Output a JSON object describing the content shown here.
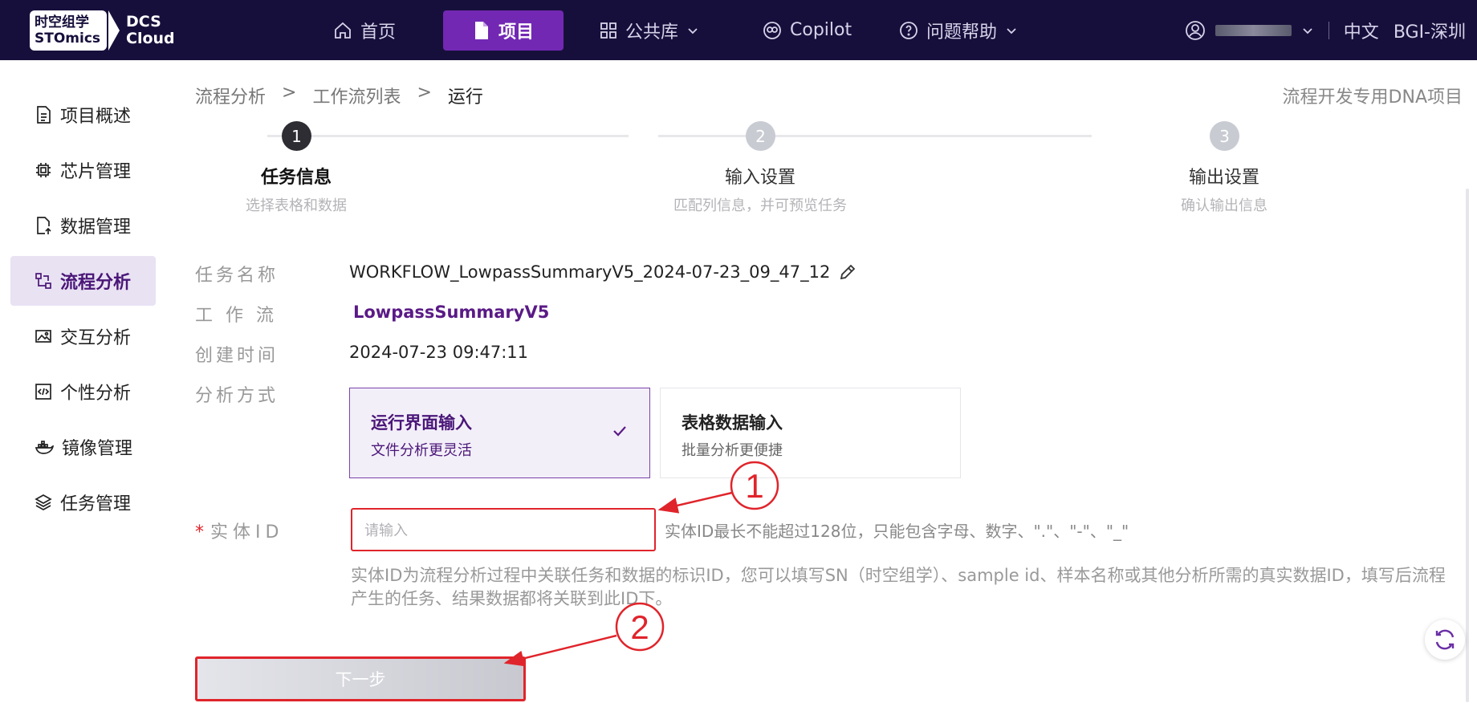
{
  "brand": {
    "logo_line1": "时空组学",
    "logo_line2": "STOmics",
    "product_line1": "DCS",
    "product_line2": "Cloud"
  },
  "nav": [
    {
      "label": "首页",
      "icon": "home-icon",
      "active": false
    },
    {
      "label": "项目",
      "icon": "document-icon",
      "active": true
    },
    {
      "label": "公共库",
      "icon": "grid-icon",
      "active": false,
      "dropdown": true
    },
    {
      "label": "Copilot",
      "icon": "copilot-icon",
      "active": false
    },
    {
      "label": "问题帮助",
      "icon": "help-icon",
      "active": false,
      "dropdown": true
    }
  ],
  "topright": {
    "language": "中文",
    "region": "BGI-深圳"
  },
  "sidebar": {
    "items": [
      {
        "label": "项目概述",
        "icon": "overview-icon"
      },
      {
        "label": "芯片管理",
        "icon": "chip-icon"
      },
      {
        "label": "数据管理",
        "icon": "data-file-icon"
      },
      {
        "label": "流程分析",
        "icon": "workflow-icon",
        "active": true
      },
      {
        "label": "交互分析",
        "icon": "image-icon"
      },
      {
        "label": "个性分析",
        "icon": "code-icon"
      },
      {
        "label": "镜像管理",
        "icon": "docker-icon"
      },
      {
        "label": "任务管理",
        "icon": "layers-icon"
      }
    ]
  },
  "breadcrumb": {
    "items": [
      "流程分析",
      "工作流列表",
      "运行"
    ],
    "separator": ">"
  },
  "project_name": "流程开发专用DNA项目",
  "steps": [
    {
      "number": "1",
      "title": "任务信息",
      "subtitle": "选择表格和数据",
      "active": true
    },
    {
      "number": "2",
      "title": "输入设置",
      "subtitle": "匹配列信息，并可预览任务",
      "active": false
    },
    {
      "number": "3",
      "title": "输出设置",
      "subtitle": "确认输出信息",
      "active": false
    }
  ],
  "form": {
    "task_name_label": "任务名称",
    "task_name_value": "WORKFLOW_LowpassSummaryV5_2024-07-23_09_47_12",
    "workflow_label": "工作流",
    "workflow_value": "LowpassSummaryV5",
    "created_label": "创建时间",
    "created_value": "2024-07-23 09:47:11",
    "method_label": "分析方式",
    "methods": [
      {
        "title": "运行界面输入",
        "subtitle": "文件分析更灵活",
        "selected": true
      },
      {
        "title": "表格数据输入",
        "subtitle": "批量分析更便捷",
        "selected": false
      }
    ],
    "required_mark": "*",
    "entity_label": "实体ID",
    "entity_placeholder": "请输入",
    "entity_hint": "实体ID最长不能超过128位，只能包含字母、数字、\".\"、\"-\"、\"_\"",
    "entity_desc": "实体ID为流程分析过程中关联任务和数据的标识ID，您可以填写SN（时空组学）、sample id、样本名称或其他分析所需的真实数据ID，填写后流程产生的任务、结果数据都将关联到此ID下。",
    "next_label": "下一步"
  },
  "annotations": {
    "marker1": "1",
    "marker2": "2",
    "color": "#e0242b"
  },
  "colors": {
    "topbar": "#170f3b",
    "accent": "#7228b3",
    "sidebar_active_bg": "#e9e2f3"
  }
}
